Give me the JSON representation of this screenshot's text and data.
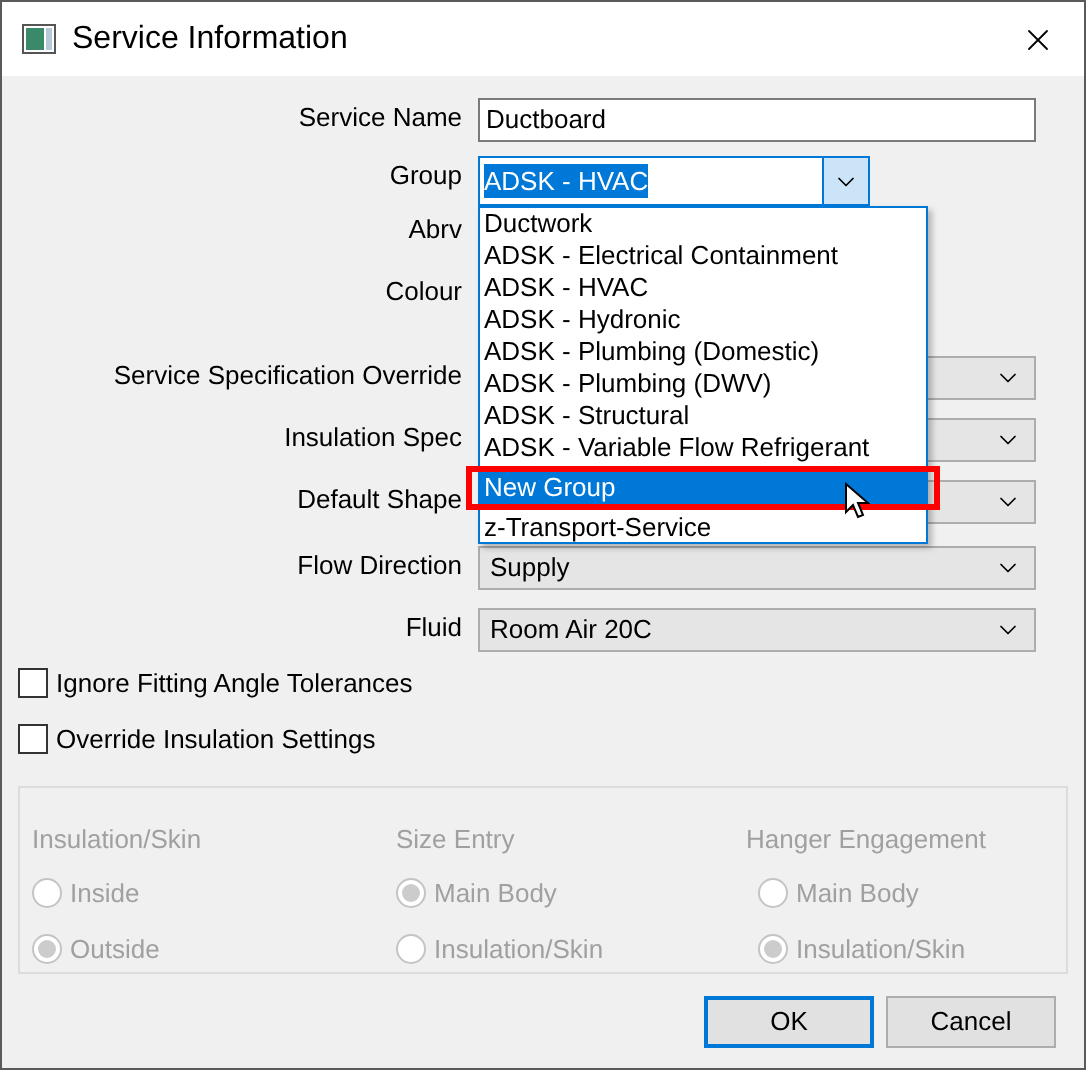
{
  "window": {
    "title": "Service Information"
  },
  "fields": [
    {
      "label": "Service Name",
      "kind": "text",
      "value": "Ductboard"
    },
    {
      "label": "Group",
      "kind": "combo_open",
      "value": "ADSK - HVAC"
    },
    {
      "label": "Abrv",
      "kind": "covered"
    },
    {
      "label": "Colour",
      "kind": "covered"
    },
    {
      "label": "Service Specification Override",
      "kind": "combo"
    },
    {
      "label": "Insulation Spec",
      "kind": "combo"
    },
    {
      "label": "Default Shape",
      "kind": "combo"
    },
    {
      "label": "Flow Direction",
      "kind": "combo",
      "value": "Supply"
    },
    {
      "label": "Fluid",
      "kind": "combo",
      "value": "Room Air 20C"
    }
  ],
  "dropdown": {
    "items": [
      {
        "label": "Ductwork",
        "selected": false,
        "outlined": false
      },
      {
        "label": "ADSK - Electrical Containment",
        "selected": false,
        "outlined": false
      },
      {
        "label": "ADSK - HVAC",
        "selected": false,
        "outlined": false
      },
      {
        "label": "ADSK - Hydronic",
        "selected": false,
        "outlined": false
      },
      {
        "label": "ADSK - Plumbing (Domestic)",
        "selected": false,
        "outlined": false
      },
      {
        "label": "ADSK - Plumbing (DWV)",
        "selected": false,
        "outlined": false
      },
      {
        "label": "ADSK - Structural",
        "selected": false,
        "outlined": false
      },
      {
        "label": "ADSK - Variable Flow Refrigerant",
        "selected": false,
        "outlined": false
      },
      {
        "label": "New Group",
        "selected": true,
        "outlined": true
      },
      {
        "label": "z-Transport-Service",
        "selected": false,
        "outlined": false
      }
    ]
  },
  "checkboxes": [
    {
      "label": "Ignore Fitting Angle Tolerances",
      "checked": false
    },
    {
      "label": "Override Insulation Settings",
      "checked": false
    }
  ],
  "options": {
    "disabled": true,
    "groups": [
      {
        "title": "Insulation/Skin",
        "options": [
          {
            "label": "Inside",
            "selected": false
          },
          {
            "label": "Outside",
            "selected": true
          }
        ]
      },
      {
        "title": "Size Entry",
        "options": [
          {
            "label": "Main Body",
            "selected": true
          },
          {
            "label": "Insulation/Skin",
            "selected": false
          }
        ]
      },
      {
        "title": "Hanger Engagement",
        "options": [
          {
            "label": "Main Body",
            "selected": false
          },
          {
            "label": "Insulation/Skin",
            "selected": true
          }
        ]
      }
    ]
  },
  "buttons": [
    {
      "label": "OK",
      "default": true
    },
    {
      "label": "Cancel",
      "default": false
    }
  ]
}
